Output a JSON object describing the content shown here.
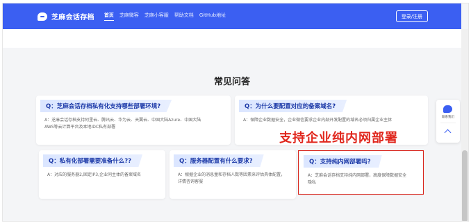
{
  "nav": {
    "brand": "芝麻会话存档",
    "items": [
      "首页",
      "芝麻微客",
      "芝麻小客服",
      "帮助文档",
      "GitHub地址"
    ],
    "login": "登录/注册"
  },
  "faq": {
    "title": "常见问答",
    "cards": [
      {
        "q": "Q：芝麻会话存档私有化支持哪些部署环境?",
        "a1": "A：芝麻会话存档支持阿里云、腾讯云、华为云、天翼云、中国大陆Azure、中国大陆",
        "a2": "AWS等云计算平台及本地IDC私有部署"
      },
      {
        "q": "Q：为什么要配置对应的备案域名?",
        "a1": "A：保障企业数据安全，企业微信要求企业内部开发配置的域名必须归属企业主体",
        "a2": ""
      },
      {
        "q": "Q：私有化部署需要准备什么??",
        "a1": "A：对应的服务器2,固定IP3,企业同主体的备案域名",
        "a2": ""
      },
      {
        "q": "Q：服务器配置有什么要求?",
        "a1": "A：根据企业的消息量和存档人数等因素来评估具体配置，",
        "a2": "详情咨询客服"
      },
      {
        "q": "Q：支持纯内网部署吗?",
        "a1": "A：芝麻会话存档支持纯内网部署，高度保障数据安全",
        "a2": "隐私"
      }
    ]
  },
  "callout": "支持企业纯内网部署",
  "float": {
    "contact": "联系我们",
    "chat_icon": "chat-icon",
    "up_icon": "chevron-up-icon"
  },
  "colors": {
    "nav": "#3b5ff2",
    "callout": "#e0261c"
  }
}
